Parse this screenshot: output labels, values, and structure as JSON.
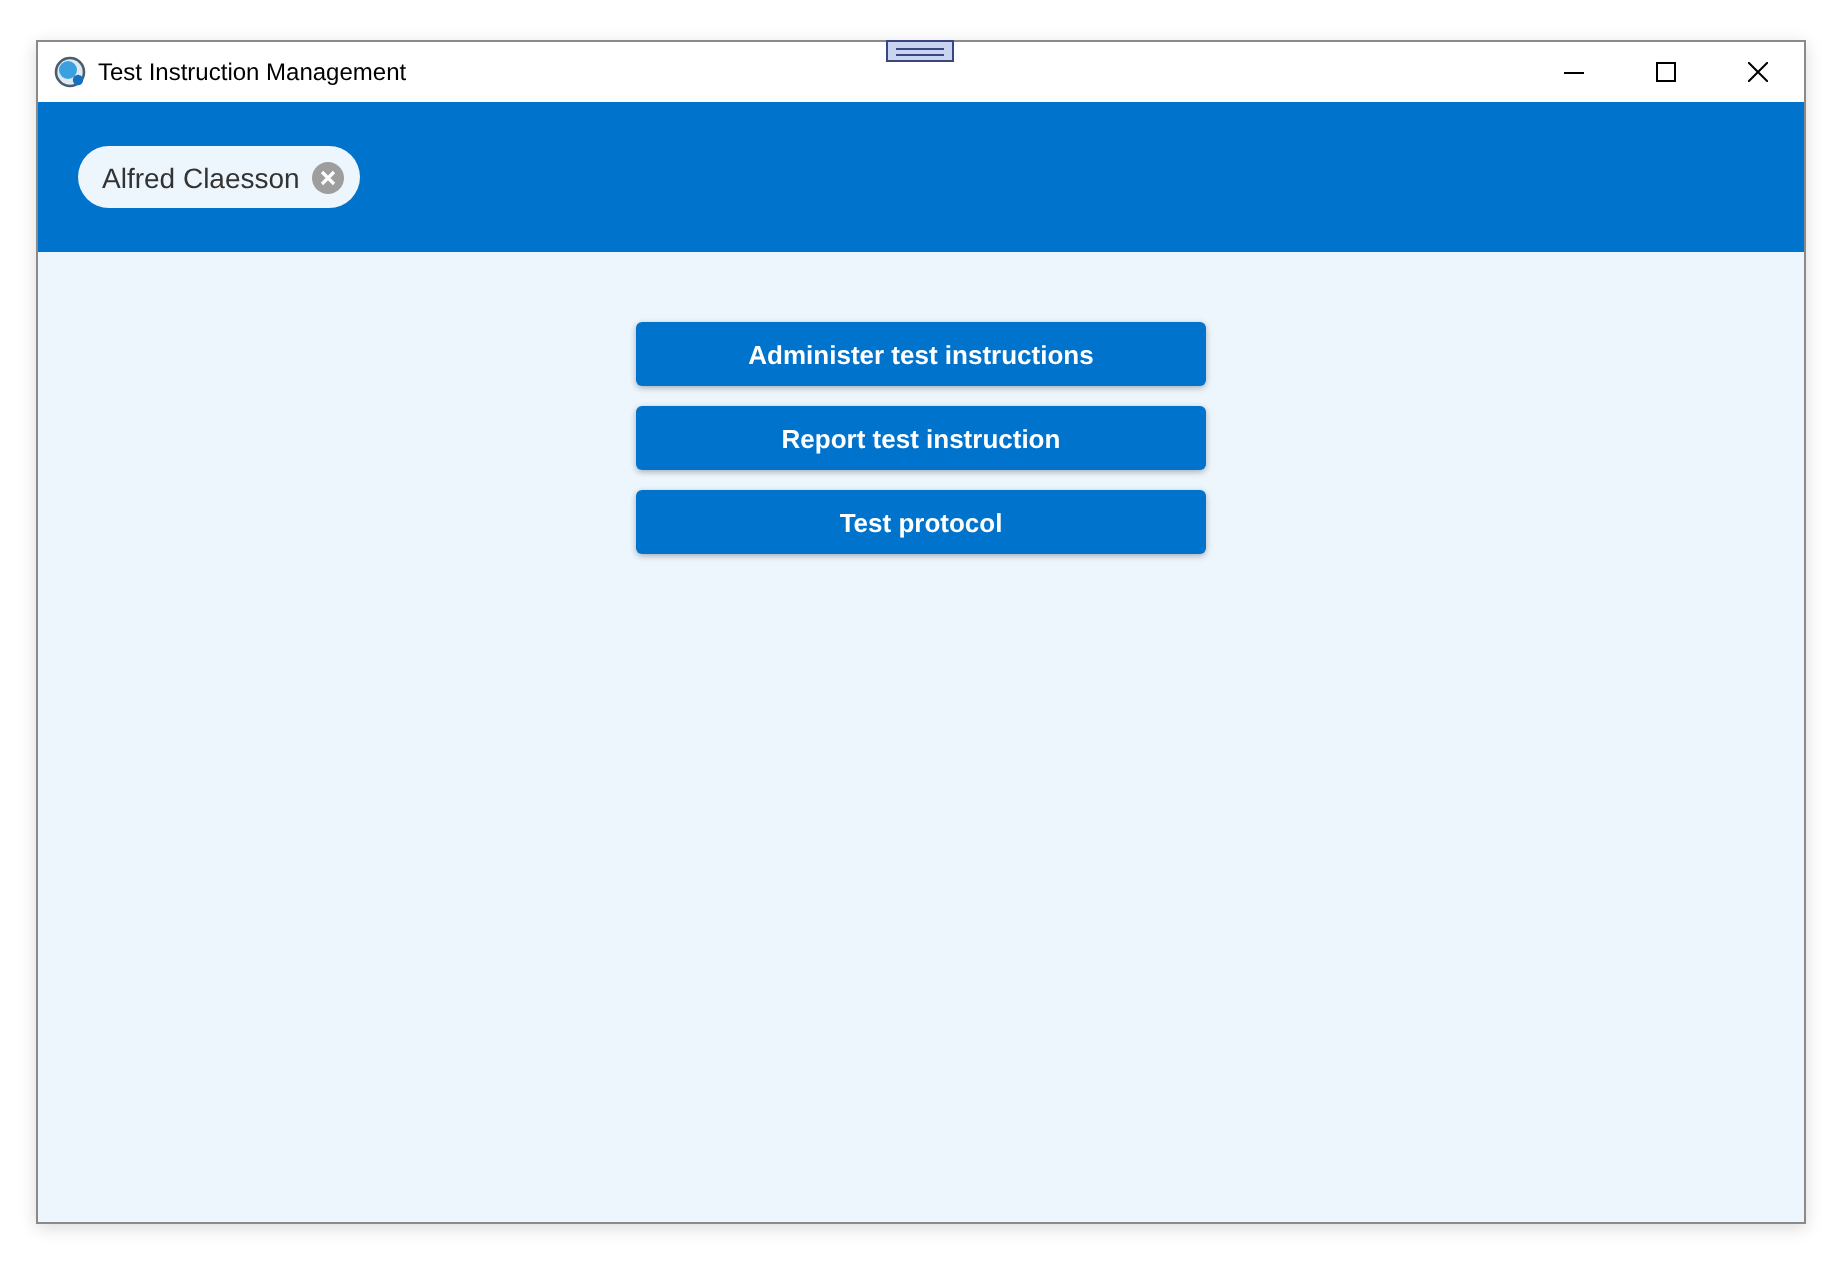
{
  "window": {
    "title": "Test Instruction Management"
  },
  "user_chip": {
    "name": "Alfred Claesson"
  },
  "buttons": [
    {
      "label": "Administer test instructions"
    },
    {
      "label": "Report test instruction"
    },
    {
      "label": "Test protocol"
    }
  ]
}
